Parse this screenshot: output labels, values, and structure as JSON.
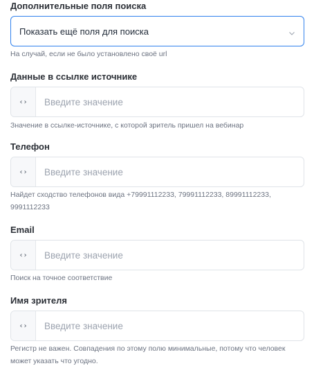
{
  "extra_search": {
    "title": "Дополнительные поля поиска",
    "select_value": "Показать ещё поля для поиска",
    "hint": "На случай, если не было установлено своё url"
  },
  "fields": [
    {
      "title": "Данные в ссылке источнике",
      "prefix": "‹›",
      "placeholder": "Введите значение",
      "value": "",
      "hint": "Значение в ссылке-источнике, с которой зритель пришел на вебинар"
    },
    {
      "title": "Телефон",
      "prefix": "‹›",
      "placeholder": "Введите значение",
      "value": "",
      "hint": "Найдет сходство телефонов вида +79991112233, 79991112233, 89991112233, 9991112233"
    },
    {
      "title": "Email",
      "prefix": "‹›",
      "placeholder": "Введите значение",
      "value": "",
      "hint": "Поиск на точное соответствие"
    },
    {
      "title": "Имя зрителя",
      "prefix": "‹›",
      "placeholder": "Введите значение",
      "value": "",
      "hint": "Регистр не важен. Совпадения по этому полю минимальные, потому что человек может указать что угодно."
    }
  ],
  "icons": {
    "select_chevron": "chevron-down-icon",
    "field_prefix": "code-brackets-icon"
  },
  "colors": {
    "focus_border": "#2f80ed",
    "border": "#dfe3e8",
    "hint_text": "#6b7280"
  }
}
